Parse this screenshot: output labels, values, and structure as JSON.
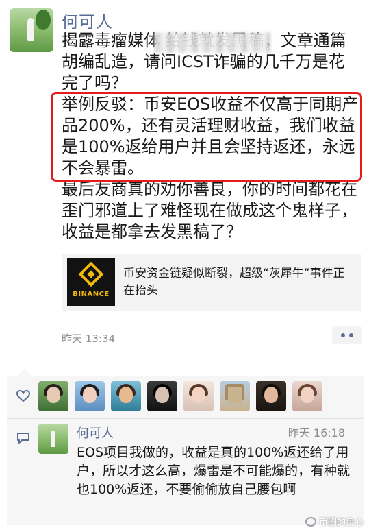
{
  "post": {
    "author": "何可人",
    "paragraphs": [
      "揭露毒瘤媒体                    给钱就发黑稿，文章通篇胡编乱造，请问ICST诈骗的几千万是花完了吗？",
      "举例反驳：币安EOS收益不仅高于同期产品200%，还有灵活理财收益，我们收益是100%返给用户并且会坚持返还，永远不会暴雷。",
      "最后友商真的劝你善良，你的时间都花在歪门邪道上了难怪现在做成这个鬼样子，收益是都拿去发黑稿了？"
    ],
    "shared_link": {
      "thumbnail_label": "BINANCE",
      "title": "币安资金链疑似断裂，超级“灰犀牛”事件正在抬头"
    },
    "time": "昨天 13:34"
  },
  "likes": {
    "icon": "heart-outline-icon",
    "avatar_count": 8
  },
  "comment": {
    "author": "何可人",
    "time": "昨天 16:18",
    "text": "EOS项目我做的，收益是真的100%返还给了用户，所以才这么高，爆雷是不可能爆的，有种就也100%返还，不要偷偷放自己腰包啊",
    "icon": "comment-bubble-icon"
  },
  "watermark": "币圈的良心",
  "colors": {
    "name_blue": "#576b95",
    "highlight_red": "#e41c1c",
    "panel_bg": "#f6f6f6",
    "binance_yellow": "#f0b90b"
  }
}
